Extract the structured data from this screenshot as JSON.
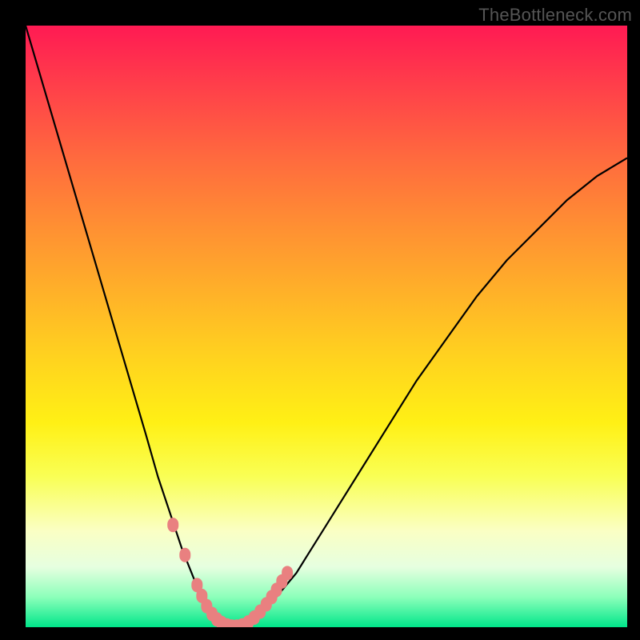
{
  "watermark": "TheBottleneck.com",
  "chart_data": {
    "type": "line",
    "title": "",
    "xlabel": "",
    "ylabel": "",
    "xlim": [
      0,
      100
    ],
    "ylim": [
      0,
      100
    ],
    "series": [
      {
        "name": "bottleneck-curve",
        "x": [
          0,
          5,
          10,
          15,
          20,
          22,
          24,
          26,
          28,
          30,
          32,
          34,
          36,
          38,
          40,
          45,
          50,
          55,
          60,
          65,
          70,
          75,
          80,
          85,
          90,
          95,
          100
        ],
        "y": [
          100,
          83,
          66,
          49,
          32,
          25,
          19,
          13,
          8,
          4,
          1,
          0,
          0,
          1,
          3,
          9,
          17,
          25,
          33,
          41,
          48,
          55,
          61,
          66,
          71,
          75,
          78
        ]
      }
    ],
    "markers": {
      "name": "highlighted-points",
      "color": "#e98080",
      "x": [
        24.5,
        26.5,
        28.5,
        29.3,
        30.1,
        31.0,
        31.8,
        32.6,
        33.5,
        34.3,
        35.1,
        36.0,
        37.0,
        38.0,
        39.0,
        40.0,
        40.9,
        41.7,
        42.6,
        43.5
      ],
      "y": [
        17.0,
        12.0,
        7.0,
        5.2,
        3.5,
        2.2,
        1.3,
        0.7,
        0.3,
        0.1,
        0.1,
        0.3,
        0.8,
        1.6,
        2.6,
        3.8,
        5.0,
        6.2,
        7.6,
        9.0
      ]
    },
    "gradient_stops": [
      {
        "pos": 0.0,
        "color": "#ff1a53"
      },
      {
        "pos": 0.5,
        "color": "#ffd21f"
      },
      {
        "pos": 0.85,
        "color": "#faffc4"
      },
      {
        "pos": 1.0,
        "color": "#00e68a"
      }
    ]
  }
}
